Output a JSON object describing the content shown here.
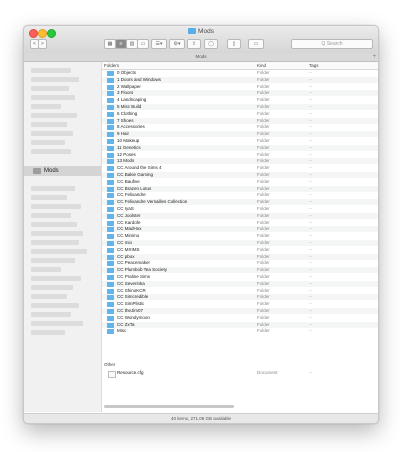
{
  "window": {
    "title": "Mods"
  },
  "toolbar": {
    "back_label": "<",
    "forward_label": ">",
    "view_icons": "icon-view",
    "view_list": "list-view",
    "view_columns": "column-view",
    "view_gallery": "gallery-view",
    "group_label": "☰▾",
    "action_label": "⚙▾",
    "search_placeholder": "Q Search"
  },
  "tab": {
    "label": "Mods",
    "plus": "+"
  },
  "sidebar": {
    "selected_label": "Mods"
  },
  "columns": {
    "name": "Folders",
    "kind": "Kind",
    "tags": "Tags"
  },
  "folders": [
    {
      "name": "0 Objects",
      "kind": "Folder",
      "tags": "--"
    },
    {
      "name": "1 Doors and Windows",
      "kind": "Folder",
      "tags": "--"
    },
    {
      "name": "2 Wallpaper",
      "kind": "Folder",
      "tags": "--"
    },
    {
      "name": "3 Floors",
      "kind": "Folder",
      "tags": "--"
    },
    {
      "name": "4 Landscaping",
      "kind": "Folder",
      "tags": "--"
    },
    {
      "name": "5 Misc Build",
      "kind": "Folder",
      "tags": "--"
    },
    {
      "name": "6 Clothing",
      "kind": "Folder",
      "tags": "--"
    },
    {
      "name": "7 Shoes",
      "kind": "Folder",
      "tags": "--"
    },
    {
      "name": "8 Accessories",
      "kind": "Folder",
      "tags": "--"
    },
    {
      "name": "9 Hair",
      "kind": "Folder",
      "tags": "--"
    },
    {
      "name": "10 Makeup",
      "kind": "Folder",
      "tags": "--"
    },
    {
      "name": "11 Genetics",
      "kind": "Folder",
      "tags": "--"
    },
    {
      "name": "12 Poses",
      "kind": "Folder",
      "tags": "--"
    },
    {
      "name": "13 Mods",
      "kind": "Folder",
      "tags": "--"
    },
    {
      "name": "CC Around the Sims 4",
      "kind": "Folder",
      "tags": "--"
    },
    {
      "name": "CC Bakie Gaming",
      "kind": "Folder",
      "tags": "--"
    },
    {
      "name": "CC Baufive",
      "kind": "Folder",
      "tags": "--"
    },
    {
      "name": "CC Brazen Lotus",
      "kind": "Folder",
      "tags": "--"
    },
    {
      "name": "CC Felixandre",
      "kind": "Folder",
      "tags": "--"
    },
    {
      "name": "CC Felixandre Versailles Collection",
      "kind": "Folder",
      "tags": "--"
    },
    {
      "name": "CC IyaS",
      "kind": "Folder",
      "tags": "--"
    },
    {
      "name": "CC Joolster",
      "kind": "Folder",
      "tags": "--"
    },
    {
      "name": "CC Kardofe",
      "kind": "Folder",
      "tags": "--"
    },
    {
      "name": "CC MadHox",
      "kind": "Folder",
      "tags": "--"
    },
    {
      "name": "CC Minimo",
      "kind": "Folder",
      "tags": "--"
    },
    {
      "name": "CC mio",
      "kind": "Folder",
      "tags": "--"
    },
    {
      "name": "CC MXIMS",
      "kind": "Folder",
      "tags": "--"
    },
    {
      "name": "CC pbox",
      "kind": "Folder",
      "tags": "--"
    },
    {
      "name": "CC Peacemaker",
      "kind": "Folder",
      "tags": "--"
    },
    {
      "name": "CC Plumbob Tea Society",
      "kind": "Folder",
      "tags": "--"
    },
    {
      "name": "CC Praline Sims",
      "kind": "Folder",
      "tags": "--"
    },
    {
      "name": "CC Severinka",
      "kind": "Folder",
      "tags": "--"
    },
    {
      "name": "CC ShinoKCR",
      "kind": "Folder",
      "tags": "--"
    },
    {
      "name": "CC Simcredible",
      "kind": "Folder",
      "tags": "--"
    },
    {
      "name": "CC SimPlistic",
      "kind": "Folder",
      "tags": "--"
    },
    {
      "name": "CC theJim07",
      "kind": "Folder",
      "tags": "--"
    },
    {
      "name": "CC Wondymoon",
      "kind": "Folder",
      "tags": "--"
    },
    {
      "name": "CC ZxTa",
      "kind": "Folder",
      "tags": "--"
    },
    {
      "name": "Misc",
      "kind": "Folder",
      "tags": "--"
    }
  ],
  "other_group": {
    "label": "Other",
    "files": [
      {
        "name": "Resource.cfg",
        "kind": "Document",
        "tags": "--"
      }
    ]
  },
  "status": {
    "text": "40 items, 271.06 GB available"
  },
  "colors": {
    "folder": "#62b4ea",
    "sidebar_bg": "#f1f1f1",
    "selection": "#d4d4d4"
  }
}
